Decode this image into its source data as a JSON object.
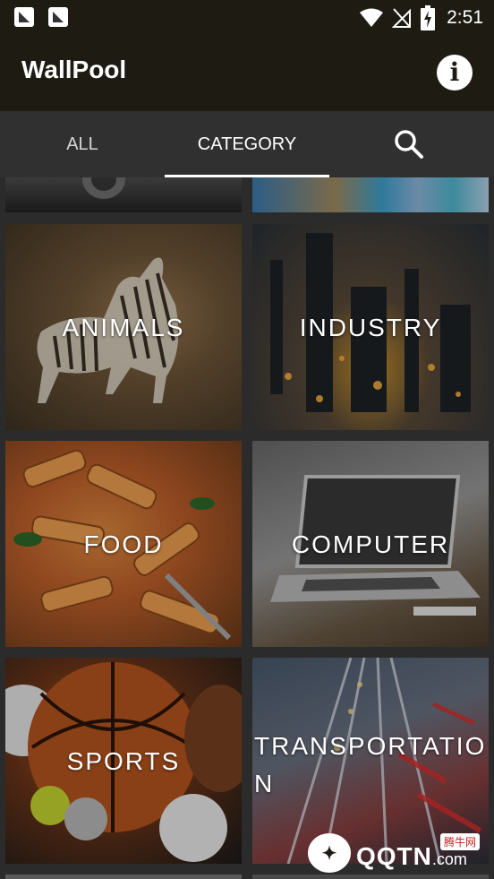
{
  "status_bar": {
    "time": "2:51",
    "notification_icons": [
      "notification-app-icon",
      "notification-app-icon"
    ],
    "system_icons": [
      "wifi-icon",
      "no-signal-icon",
      "battery-charging-icon"
    ]
  },
  "app_bar": {
    "title": "WallPool",
    "info_icon": "info-icon",
    "info_glyph": "i"
  },
  "tabs": [
    {
      "label": "ALL",
      "active": false
    },
    {
      "label": "CATEGORY",
      "active": true
    },
    {
      "icon": "search-icon"
    }
  ],
  "categories": [
    {
      "label": ""
    },
    {
      "label": ""
    },
    {
      "label": "ANIMALS"
    },
    {
      "label": "INDUSTRY"
    },
    {
      "label": "FOOD"
    },
    {
      "label": "COMPUTER"
    },
    {
      "label": "SPORTS"
    },
    {
      "label": "TRANSPORTATIO\nN"
    },
    {
      "label": ""
    },
    {
      "label": ""
    }
  ],
  "watermark": {
    "brand": "QQTN",
    "domain": ".com",
    "tag": "腾牛网"
  },
  "colors": {
    "app_bar": "#1e1c12",
    "tab_bar": "#303030",
    "background": "#2b2b2b",
    "text": "#ffffff"
  }
}
